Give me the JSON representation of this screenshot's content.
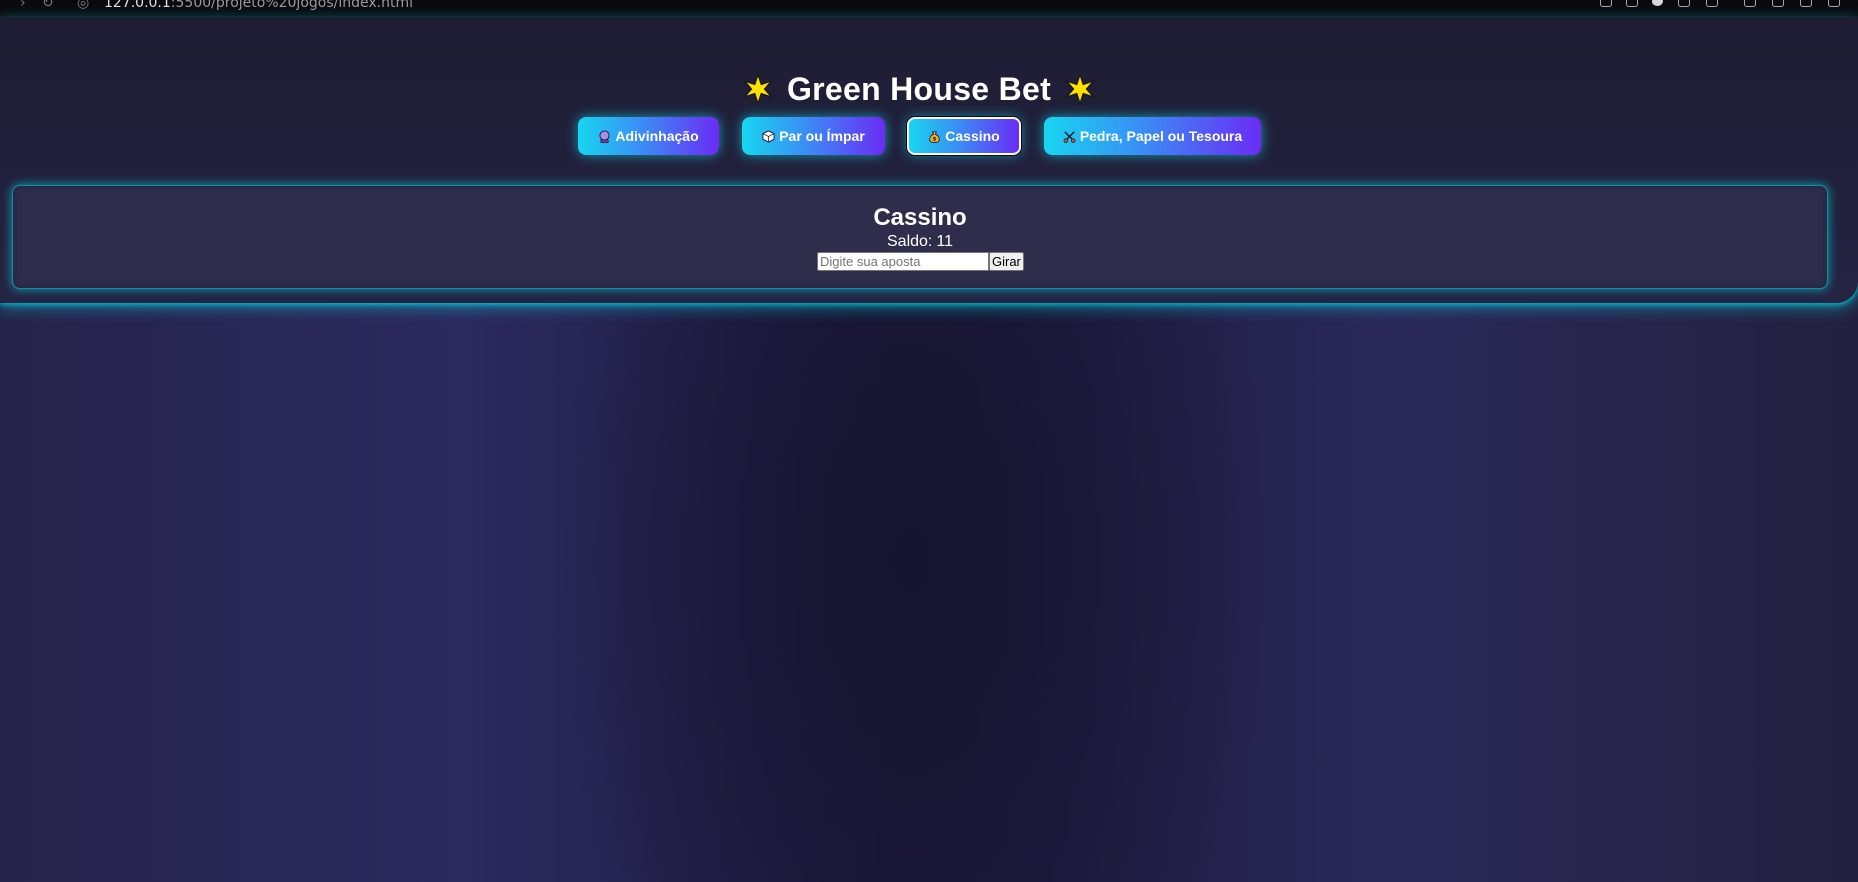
{
  "browser": {
    "url_host": "127.0.0.1",
    "url_rest": ":5500/projeto%20jogos/index.html"
  },
  "header": {
    "title": "Green House Bet",
    "title_left_icon": "star-icon",
    "title_right_icon": "star-icon"
  },
  "nav": {
    "buttons": [
      {
        "label": "Adivinhação",
        "icon": "crystal-ball-icon",
        "active": false
      },
      {
        "label": "Par ou Ímpar",
        "icon": "dice-icon",
        "active": false
      },
      {
        "label": "Cassino",
        "icon": "money-bag-icon",
        "active": true
      },
      {
        "label": "Pedra, Papel ou Tesoura",
        "icon": "scissors-icon",
        "active": false
      }
    ]
  },
  "game": {
    "title": "Cassino",
    "balance_label": "Saldo:",
    "balance_value": "11",
    "bet_placeholder": "Digite sua aposta",
    "spin_label": "Girar"
  },
  "colors": {
    "button_gradient_start": "#18d6f0",
    "button_gradient_end": "#6a2cf5",
    "glow": "#00d2e1",
    "card_background": "#2f2d4c",
    "star": "#ffe100"
  }
}
